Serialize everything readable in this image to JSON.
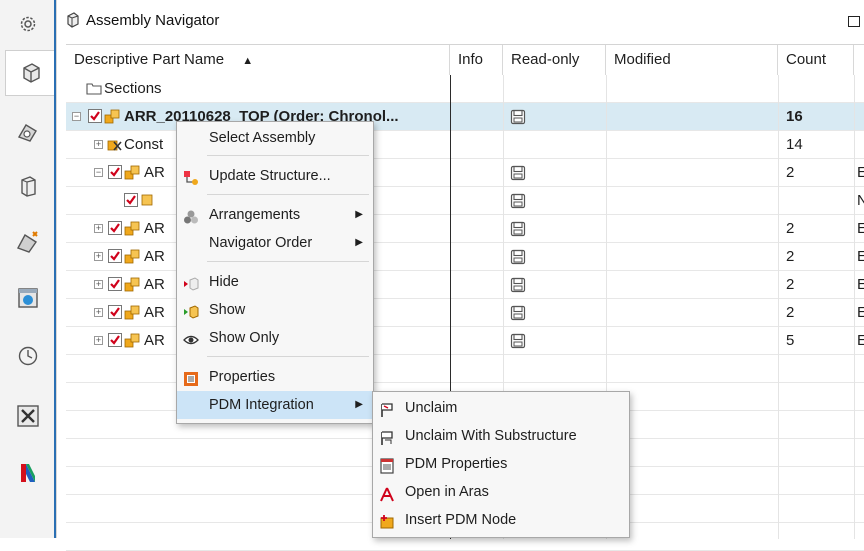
{
  "window": {
    "title": "Assembly Navigator"
  },
  "rail": {
    "icons": [
      "settings-gear-icon",
      "assembly-navigator-icon",
      "constraint-navigator-icon",
      "part-navigator-icon",
      "reuse-library-icon",
      "web-browser-icon",
      "history-icon",
      "process-studio-icon",
      "palette-icon"
    ]
  },
  "columns": {
    "name": "Descriptive Part Name",
    "info": "Info",
    "readonly": "Read-only",
    "modified": "Modified",
    "count": "Count",
    "sort_indicator": "▲"
  },
  "rows": [
    {
      "name": "Sections",
      "count": "",
      "extra": "",
      "disk": false
    },
    {
      "name": "ARR_20110628_TOP (Order: Chronol...",
      "count": "16",
      "extra": "",
      "disk": true
    },
    {
      "name": "Const",
      "count": "14",
      "extra": "",
      "disk": false
    },
    {
      "name": "AR",
      "count": "2",
      "extra": "E",
      "disk": true
    },
    {
      "name": "",
      "count": "",
      "extra": "N",
      "disk": true
    },
    {
      "name": "AR",
      "count": "2",
      "extra": "E",
      "disk": true
    },
    {
      "name": "AR",
      "count": "2",
      "extra": "E",
      "disk": true
    },
    {
      "name": "AR",
      "count": "2",
      "extra": "E",
      "disk": true
    },
    {
      "name": "AR",
      "count": "2",
      "extra": "E",
      "disk": true
    },
    {
      "name": "AR",
      "count": "5",
      "extra": "E",
      "disk": true
    }
  ],
  "context_menu": {
    "items": [
      {
        "label": "Select Assembly"
      },
      {
        "label": "Update Structure..."
      },
      {
        "label": "Arrangements"
      },
      {
        "label": "Navigator Order"
      },
      {
        "label": "Hide"
      },
      {
        "label": "Show"
      },
      {
        "label": "Show Only"
      },
      {
        "label": "Properties"
      },
      {
        "label": "PDM Integration"
      }
    ]
  },
  "submenu": {
    "items": [
      {
        "label": "Unclaim"
      },
      {
        "label": "Unclaim With Substructure"
      },
      {
        "label": "PDM Properties"
      },
      {
        "label": "Open in Aras"
      },
      {
        "label": "Insert PDM Node"
      }
    ]
  },
  "colors": {
    "selection_row": "#d8eaf3",
    "menu_highlight": "#cce4f7",
    "check_red": "#d0021b",
    "assembly_orange": "#f0a81c"
  }
}
